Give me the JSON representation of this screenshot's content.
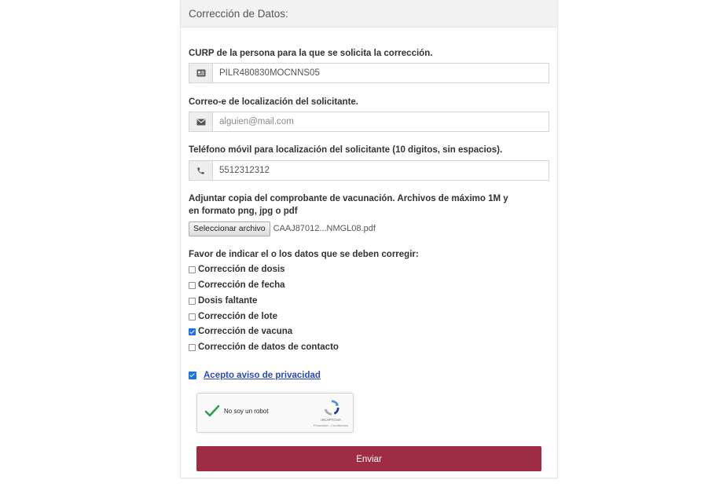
{
  "form": {
    "title": "Corrección de Datos:",
    "curp": {
      "label": "CURP de la persona para la que se solicita la corrección.",
      "value": "PILR480830MOCNNS05",
      "icon": "id-card-icon"
    },
    "email": {
      "label": "Correo-e de localización del solicitante.",
      "placeholder": "alguien@mail.com",
      "icon": "envelope-icon"
    },
    "phone": {
      "label": "Teléfono móvil para localización del solicitante (10 digitos, sin espacios).",
      "value": "5512312312",
      "icon": "phone-icon"
    },
    "attachment": {
      "label_line1": "Adjuntar copia del comprobante de vacunación. Archivos de máximo 1M y",
      "label_line2": "en formato png, jpg o pdf",
      "button_label": "Seleccionar archivo",
      "file_name": "CAAJ87012...NMGL08.pdf"
    },
    "corrections": {
      "label": "Favor de indicar el o los datos que se deben corregir:",
      "options": [
        {
          "label": "Corrección de dosis",
          "checked": false
        },
        {
          "label": "Corrección de fecha",
          "checked": false
        },
        {
          "label": "Dosis faltante",
          "checked": false
        },
        {
          "label": "Corrección de lote",
          "checked": false
        },
        {
          "label": "Corrección de vacuna",
          "checked": true
        },
        {
          "label": "Corrección de datos de contacto",
          "checked": false
        }
      ]
    },
    "privacy": {
      "label": "Acepto aviso de privacidad",
      "checked": true
    },
    "recaptcha": {
      "label": "No soy un robot",
      "brand": "reCAPTCHA",
      "terms": "Privacidad - Condiciones"
    },
    "submit_label": "Enviar"
  },
  "colors": {
    "submit": "#9e2c45",
    "checkbox_checked": "#1a73e8",
    "link": "#2a47c4",
    "header_bg": "#f2f2f2"
  }
}
